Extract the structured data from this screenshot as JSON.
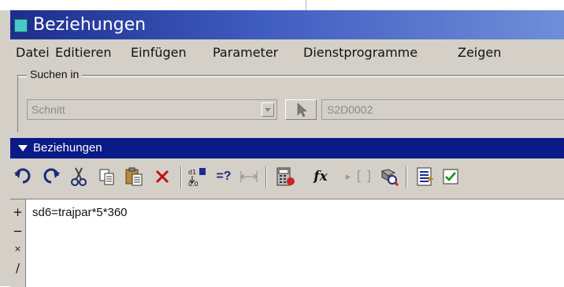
{
  "window": {
    "title": "Beziehungen"
  },
  "menu": [
    "Datei",
    "Editieren",
    "Einfügen",
    "Parameter",
    "Dienstprogramme",
    "Zeigen"
  ],
  "search": {
    "group_label": "Suchen in",
    "combo_value": "Schnitt",
    "target_value": "S2D0002"
  },
  "section": {
    "title": "Beziehungen"
  },
  "toolbar_icons": [
    "undo-icon",
    "redo-icon",
    "cut-icon",
    "copy-icon",
    "paste-icon",
    "delete-icon",
    "sort-icon",
    "evaluate-icon",
    "dimension-icon",
    "calculator-icon",
    "function-icon",
    "brackets-icon",
    "inspect-icon",
    "list-icon",
    "verify-icon"
  ],
  "gutter": [
    "+",
    "−",
    "×",
    "/"
  ],
  "editor": {
    "line": "sd6=trajpar*5*360"
  },
  "colors": {
    "titlebar_start": "#1c2e8c",
    "titlebar_end": "#6e8fd8",
    "section_bg": "#0a1a86",
    "window_bg": "#d4d0c8"
  }
}
